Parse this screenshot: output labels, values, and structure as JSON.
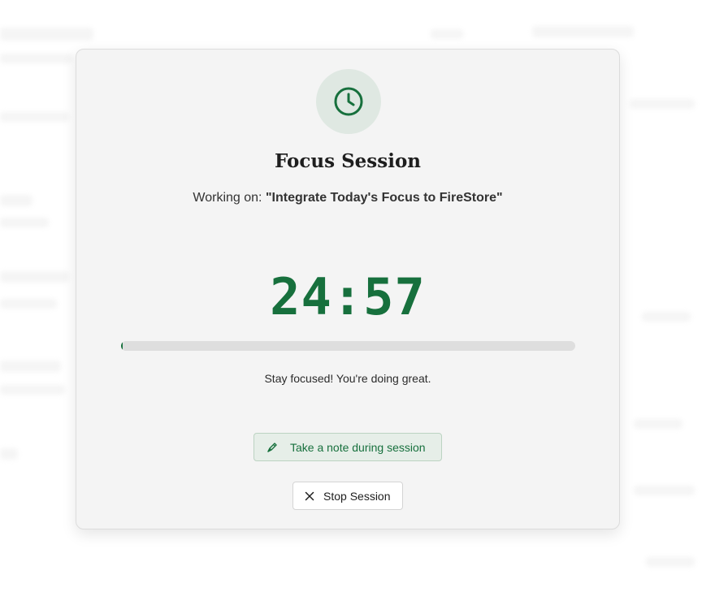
{
  "session": {
    "title": "Focus Session",
    "working_prefix": "Working on: ",
    "task_name": "\"Integrate Today's Focus to FireStore\"",
    "timer_display": "24:57",
    "progress_fraction": 0.002,
    "encouragement": "Stay focused! You're doing great."
  },
  "actions": {
    "note_label": "Take a note during session",
    "stop_label": "Stop Session"
  },
  "icons": {
    "badge": "clock-icon",
    "note": "pen-icon",
    "stop": "close-icon"
  },
  "colors": {
    "accent": "#17703d",
    "badge_bg": "#dfe8e2",
    "modal_bg": "#f4f4f4",
    "progress_track": "#dedede"
  }
}
